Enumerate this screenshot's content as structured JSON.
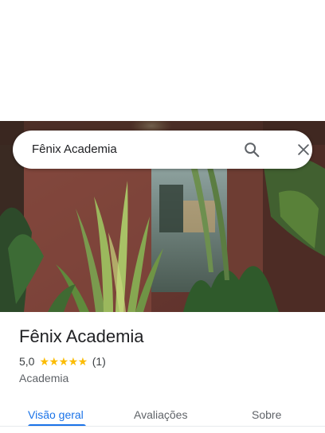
{
  "search": {
    "query": "Fênix Academia",
    "search_icon": "search-icon",
    "close_icon": "close-icon"
  },
  "place": {
    "name": "Fênix Academia",
    "rating": "5,0",
    "rating_out_of_5": 5,
    "stars": "★★★★★",
    "review_count": "(1)",
    "category": "Academia"
  },
  "tabs": [
    {
      "label": "Visão geral",
      "active": true
    },
    {
      "label": "Avaliações",
      "active": false
    },
    {
      "label": "Sobre",
      "active": false
    }
  ],
  "colors": {
    "accent": "#1a73e8",
    "star": "#fbbc04",
    "text_primary": "#202124",
    "text_secondary": "#5f6368"
  }
}
